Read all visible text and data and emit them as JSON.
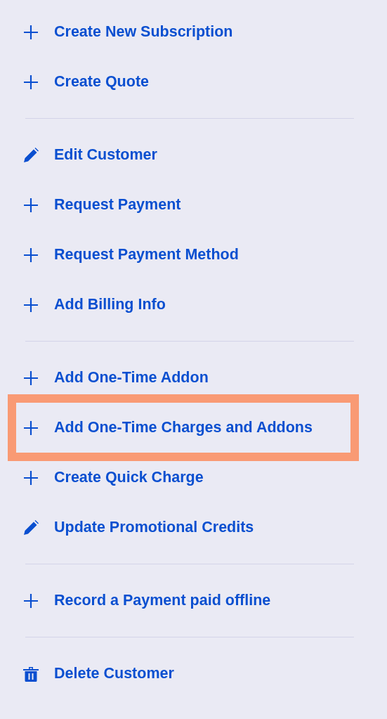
{
  "menu": {
    "sections": [
      {
        "items": [
          {
            "label": "Create New Subscription",
            "kind": "plus",
            "highlighted": false
          },
          {
            "label": "Create Quote",
            "kind": "plus",
            "highlighted": false
          }
        ]
      },
      {
        "items": [
          {
            "label": "Edit Customer",
            "kind": "pencil",
            "highlighted": false
          },
          {
            "label": "Request Payment",
            "kind": "plus",
            "highlighted": false
          },
          {
            "label": "Request Payment Method",
            "kind": "plus",
            "highlighted": false
          },
          {
            "label": "Add Billing Info",
            "kind": "plus",
            "highlighted": false
          }
        ]
      },
      {
        "items": [
          {
            "label": "Add One-Time Addon",
            "kind": "plus",
            "highlighted": false
          },
          {
            "label": "Add One-Time Charges and Addons",
            "kind": "plus",
            "highlighted": true
          },
          {
            "label": "Create Quick Charge",
            "kind": "plus",
            "highlighted": false
          },
          {
            "label": "Update Promotional Credits",
            "kind": "pencil",
            "highlighted": false
          }
        ]
      },
      {
        "items": [
          {
            "label": "Record a Payment paid offline",
            "kind": "plus",
            "highlighted": false
          }
        ]
      },
      {
        "items": [
          {
            "label": "Delete Customer",
            "kind": "trash",
            "highlighted": false
          }
        ]
      }
    ]
  }
}
